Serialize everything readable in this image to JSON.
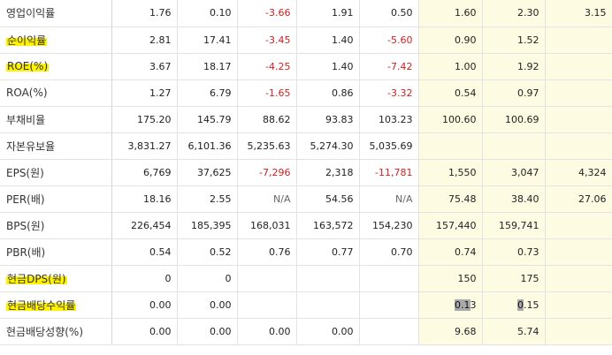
{
  "table": {
    "rows": [
      {
        "label": "영업이익률",
        "highlight": false,
        "values": [
          "1.76",
          "0.10",
          "-3.66",
          "1.91",
          "0.50",
          "1.60",
          "2.30",
          "3.15"
        ]
      },
      {
        "label": "순이익률",
        "highlight": true,
        "values": [
          "2.81",
          "17.41",
          "-3.45",
          "1.40",
          "-5.60",
          "0.90",
          "1.52",
          ""
        ]
      },
      {
        "label": "ROE(%)",
        "highlight": true,
        "values": [
          "3.67",
          "18.17",
          "-4.25",
          "1.40",
          "-7.42",
          "1.00",
          "1.92",
          ""
        ]
      },
      {
        "label": "ROA(%)",
        "highlight": false,
        "values": [
          "1.27",
          "6.79",
          "-1.65",
          "0.86",
          "-3.32",
          "0.54",
          "0.97",
          ""
        ]
      },
      {
        "label": "부채비율",
        "highlight": false,
        "values": [
          "175.20",
          "145.79",
          "88.62",
          "93.83",
          "103.23",
          "100.60",
          "100.69",
          ""
        ]
      },
      {
        "label": "자본유보율",
        "highlight": false,
        "values": [
          "3,831.27",
          "6,101.36",
          "5,235.63",
          "5,274.30",
          "5,035.69",
          "",
          "",
          ""
        ]
      },
      {
        "label": "EPS(원)",
        "highlight": false,
        "values": [
          "6,769",
          "37,625",
          "-7,296",
          "2,318",
          "-11,781",
          "1,550",
          "3,047",
          "4,324"
        ]
      },
      {
        "label": "PER(배)",
        "highlight": false,
        "values": [
          "18.16",
          "2.55",
          "N/A",
          "54.56",
          "N/A",
          "75.48",
          "38.40",
          "27.06"
        ]
      },
      {
        "label": "BPS(원)",
        "highlight": false,
        "values": [
          "226,454",
          "185,395",
          "168,031",
          "163,572",
          "154,230",
          "157,440",
          "159,741",
          ""
        ]
      },
      {
        "label": "PBR(배)",
        "highlight": false,
        "values": [
          "0.54",
          "0.52",
          "0.76",
          "0.77",
          "0.70",
          "0.74",
          "0.73",
          ""
        ]
      },
      {
        "label": "현금DPS(원)",
        "highlight": true,
        "values": [
          "0",
          "0",
          "",
          "",
          "",
          "150",
          "175",
          ""
        ]
      },
      {
        "label": "현금배당수익률",
        "highlight": true,
        "values": [
          "0.00",
          "0.00",
          "",
          "",
          "",
          "0.13",
          "0.15",
          ""
        ]
      },
      {
        "label": "현금배당성향(%)",
        "highlight": false,
        "values": [
          "0.00",
          "0.00",
          "0.00",
          "0.00",
          "",
          "9.68",
          "5.74",
          ""
        ]
      }
    ]
  },
  "colors": {
    "negative": "#d21f1f",
    "estimate_background": "#fdfbe2",
    "highlighter": "#fff200",
    "selection": "#a9a9a9"
  }
}
